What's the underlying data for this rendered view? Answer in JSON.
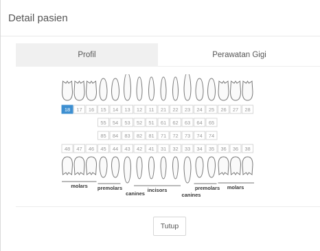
{
  "modal": {
    "title": "Detail pasien"
  },
  "tabs": [
    {
      "label": "Profil",
      "active": true
    },
    {
      "label": "Perawatan Gigi",
      "active": false
    }
  ],
  "chart": {
    "upper_permanent": [
      "18",
      "17",
      "16",
      "15",
      "14",
      "13",
      "12",
      "11",
      "21",
      "22",
      "23",
      "24",
      "25",
      "26",
      "27",
      "28"
    ],
    "upper_primary": [
      "55",
      "54",
      "53",
      "52",
      "51",
      "61",
      "62",
      "63",
      "64",
      "65"
    ],
    "lower_primary": [
      "85",
      "84",
      "83",
      "82",
      "81",
      "71",
      "72",
      "73",
      "74",
      "74"
    ],
    "lower_permanent": [
      "48",
      "47",
      "46",
      "45",
      "44",
      "43",
      "42",
      "41",
      "31",
      "32",
      "33",
      "34",
      "35",
      "36",
      "36",
      "38"
    ],
    "selected": "18",
    "labels": {
      "molars_left": "molars",
      "premolars_left": "premolars",
      "canines_left": "canines",
      "incisors": "incisors",
      "canines_right": "canines",
      "premolars_right": "premolars",
      "molars_right": "molars"
    },
    "colors": {
      "selected_fill": "#3d8fd1",
      "cell_border": "#d6d6d6",
      "cell_text": "#999999"
    }
  },
  "footer": {
    "close_label": "Tutup"
  }
}
